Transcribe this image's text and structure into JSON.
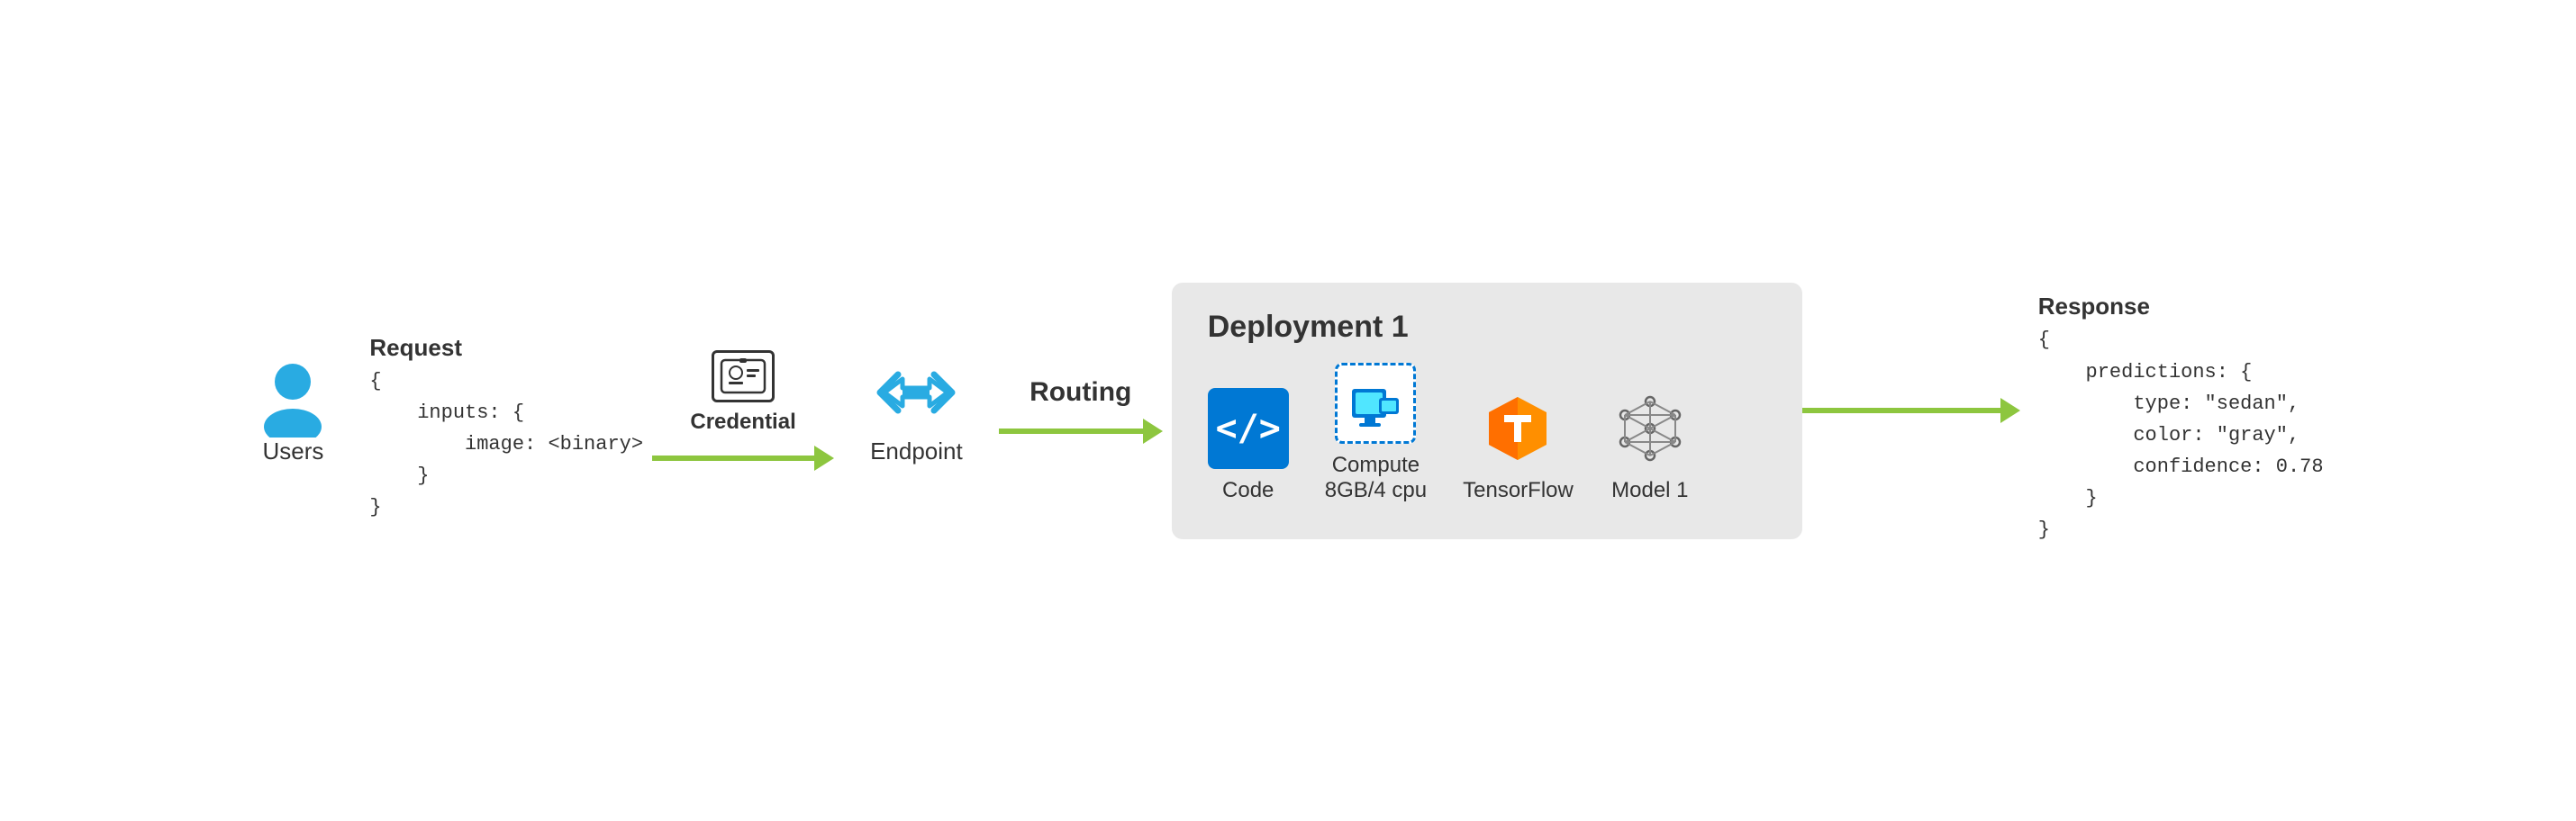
{
  "users": {
    "label": "Users"
  },
  "request": {
    "label": "Request",
    "code": "{\n    inputs: {\n        image: <binary>\n    }\n}"
  },
  "credential": {
    "label": "Credential"
  },
  "endpoint": {
    "label": "Endpoint"
  },
  "routing": {
    "label": "Routing"
  },
  "deployment": {
    "title": "Deployment 1",
    "items": [
      {
        "id": "code",
        "label": "Code"
      },
      {
        "id": "compute",
        "label": "Compute\n8GB/4 cpu"
      },
      {
        "id": "tensorflow",
        "label": "TensorFlow"
      },
      {
        "id": "model",
        "label": "Model 1"
      }
    ]
  },
  "response": {
    "label": "Response",
    "code": "{\n    predictions: {\n        type: \"sedan\",\n        color: \"gray\",\n        confidence: 0.78\n    }\n}"
  },
  "colors": {
    "arrow": "#8dc63f",
    "azure_blue": "#0078d4",
    "text_dark": "#333333"
  }
}
